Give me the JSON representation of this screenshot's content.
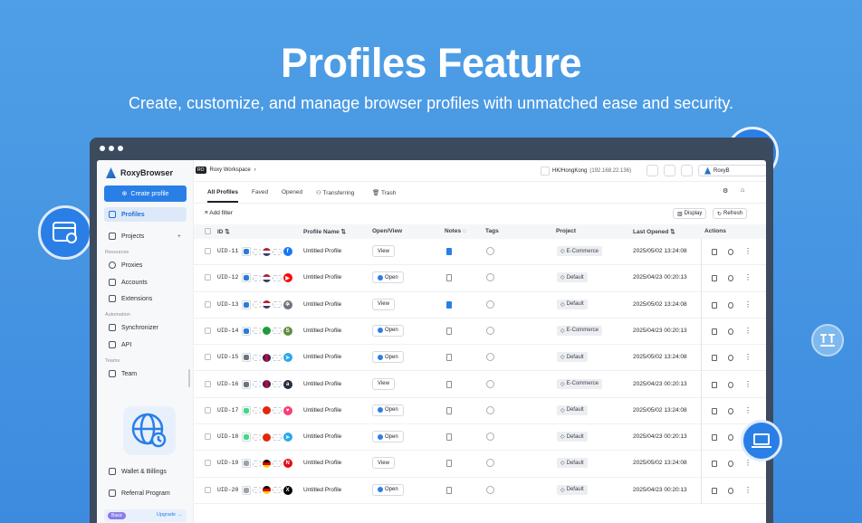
{
  "hero": {
    "title": "Profiles Feature",
    "subtitle": "Create, customize, and manage browser profiles with unmatched ease and security."
  },
  "sidebar": {
    "brand": "RoxyBrowser",
    "create_label": "Create profile",
    "nav": [
      {
        "label": "Profiles",
        "icon": "profiles-icon",
        "active": true
      },
      {
        "label": "Projects",
        "icon": "projects-icon"
      }
    ],
    "resources_label": "Resources",
    "resources": [
      {
        "label": "Proxies",
        "icon": "globe-icon"
      },
      {
        "label": "Accounts",
        "icon": "accounts-icon"
      },
      {
        "label": "Extensions",
        "icon": "extensions-icon"
      }
    ],
    "automation_label": "Automation",
    "automation": [
      {
        "label": "Synchronizer",
        "icon": "sync-icon"
      },
      {
        "label": "API",
        "icon": "api-icon"
      }
    ],
    "teams_label": "Teams",
    "teams": [
      {
        "label": "Team",
        "icon": "team-icon"
      }
    ],
    "bottom": [
      {
        "label": "Wallet & Billings",
        "icon": "wallet-icon"
      },
      {
        "label": "Referral Program",
        "icon": "gift-icon"
      }
    ],
    "plan_badge": "Basic",
    "upgrade_label": "Upgrade →"
  },
  "topbar": {
    "workspace_badge": "RO",
    "workspace": "Roxy Workspace",
    "location": "HK/HongKong",
    "ip": "(192.168.22.136)",
    "account": "RoxyB"
  },
  "tabs": [
    "All Profiles",
    "Faved",
    "Opened",
    "Transferring",
    "Trash"
  ],
  "filterbar": {
    "add_filter": "Add filter",
    "display": "Display",
    "refresh": "Refresh"
  },
  "columns": [
    "ID",
    "Profile Name",
    "Open/View",
    "Notes",
    "Tags",
    "Project",
    "Last Opened",
    "Actions"
  ],
  "rows": [
    {
      "id": "UID-11",
      "name": "Untitled Profile",
      "action": "View",
      "note": true,
      "project": "E-Commerce",
      "last": "2025/05/02 13:24:08",
      "os": "windows",
      "flag": "us",
      "site": "facebook"
    },
    {
      "id": "UID-12",
      "name": "Untitled Profile",
      "action": "Open",
      "note": false,
      "project": "Default",
      "last": "2025/04/23 00:20:13",
      "os": "windows",
      "flag": "us",
      "site": "youtube"
    },
    {
      "id": "UID-13",
      "name": "Untitled Profile",
      "action": "View",
      "note": true,
      "project": "Default",
      "last": "2025/05/02 13:24:08",
      "os": "windows",
      "flag": "us",
      "site": "chatgpt"
    },
    {
      "id": "UID-14",
      "name": "Untitled Profile",
      "action": "Open",
      "note": false,
      "project": "E-Commerce",
      "last": "2025/04/23 00:20:13",
      "os": "windows",
      "flag": "br",
      "site": "shopify"
    },
    {
      "id": "UID-15",
      "name": "Untitled Profile",
      "action": "Open",
      "note": false,
      "project": "Default",
      "last": "2025/05/02 13:24:08",
      "os": "mac",
      "flag": "gb",
      "site": "telegram"
    },
    {
      "id": "UID-16",
      "name": "Untitled Profile",
      "action": "View",
      "note": false,
      "project": "E-Commerce",
      "last": "2025/04/23 00:20:13",
      "os": "mac",
      "flag": "gb",
      "site": "amazon"
    },
    {
      "id": "UID-17",
      "name": "Untitled Profile",
      "action": "Open",
      "note": false,
      "project": "Default",
      "last": "2025/05/02 13:24:08",
      "os": "android",
      "flag": "hk",
      "site": "tinder"
    },
    {
      "id": "UID-18",
      "name": "Untitled Profile",
      "action": "Open",
      "note": false,
      "project": "Default",
      "last": "2025/04/23 00:20:13",
      "os": "android",
      "flag": "hk",
      "site": "telegram"
    },
    {
      "id": "UID-19",
      "name": "Untitled Profile",
      "action": "View",
      "note": false,
      "project": "Default",
      "last": "2025/05/02 13:24:08",
      "os": "ios",
      "flag": "de",
      "site": "netflix"
    },
    {
      "id": "UID-20",
      "name": "Untitled Profile",
      "action": "Open",
      "note": false,
      "project": "Default",
      "last": "2025/04/23 00:20:13",
      "os": "ios",
      "flag": "de",
      "site": "x"
    }
  ],
  "colors": {
    "accent": "#2a7fe6",
    "bg": "#4f9fe6"
  }
}
